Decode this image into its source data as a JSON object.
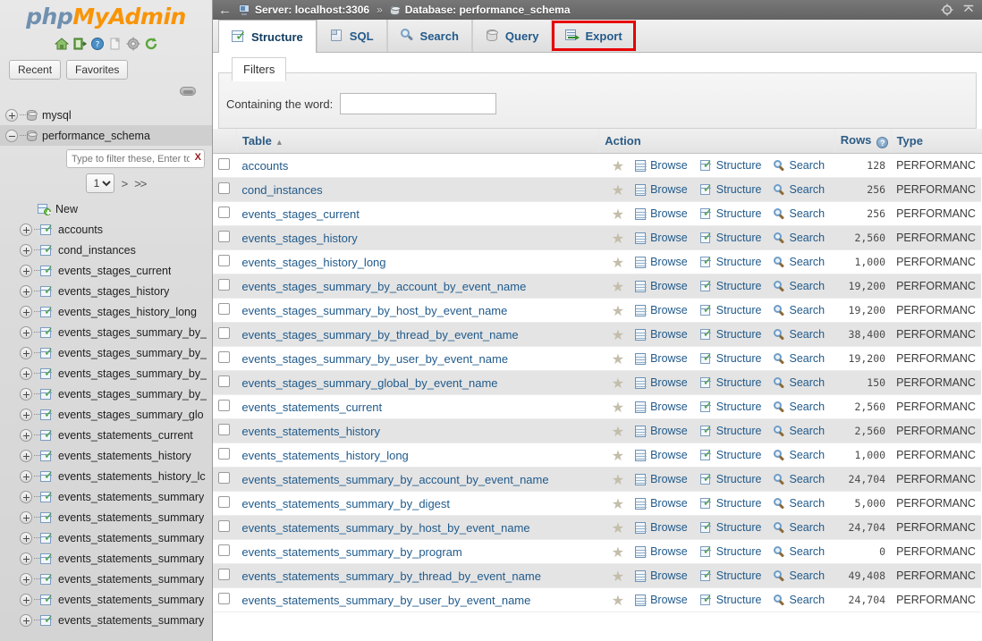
{
  "app": {
    "logo_php": "php",
    "logo_my": "My",
    "logo_admin": "Admin"
  },
  "sidebar": {
    "icons": [
      {
        "name": "home-icon",
        "title": "Home"
      },
      {
        "name": "logout-icon",
        "title": "Log out"
      },
      {
        "name": "help-icon",
        "title": "Documentation"
      },
      {
        "name": "docs-icon",
        "title": "phpMyAdmin documentation"
      },
      {
        "name": "settings-icon",
        "title": "Settings"
      },
      {
        "name": "reload-icon",
        "title": "Reload navigation"
      }
    ],
    "quick_buttons": [
      {
        "name": "recent-button",
        "label": "Recent"
      },
      {
        "name": "favorites-button",
        "label": "Favorites"
      }
    ],
    "tree": {
      "databases": [
        {
          "label": "mysql",
          "expanded": false
        },
        {
          "label": "performance_schema",
          "expanded": true
        }
      ],
      "filter": {
        "placeholder": "Type to filter these, Enter to searc",
        "value": "",
        "clear_label": "X"
      },
      "pager": {
        "page_value": "1",
        "options": [
          "1"
        ],
        "next_label": ">",
        "last_label": ">>"
      },
      "new_label": "New",
      "tables": [
        "accounts",
        "cond_instances",
        "events_stages_current",
        "events_stages_history",
        "events_stages_history_long",
        "events_stages_summary_by_",
        "events_stages_summary_by_",
        "events_stages_summary_by_",
        "events_stages_summary_by_",
        "events_stages_summary_glo",
        "events_statements_current",
        "events_statements_history",
        "events_statements_history_lc",
        "events_statements_summary",
        "events_statements_summary",
        "events_statements_summary",
        "events_statements_summary",
        "events_statements_summary",
        "events_statements_summary",
        "events_statements_summary"
      ]
    }
  },
  "header": {
    "back_label": "←",
    "server_label": "Server: localhost:3306",
    "separator": "»",
    "database_label": "Database: performance_schema",
    "gear_title": "Settings",
    "collapse_title": "Collapse"
  },
  "tabs": [
    {
      "label": "Structure",
      "icon": "structure-icon",
      "active": true,
      "highlighted": false
    },
    {
      "label": "SQL",
      "icon": "sql-icon",
      "active": false,
      "highlighted": false
    },
    {
      "label": "Search",
      "icon": "search-icon",
      "active": false,
      "highlighted": false
    },
    {
      "label": "Query",
      "icon": "query-icon",
      "active": false,
      "highlighted": false
    },
    {
      "label": "Export",
      "icon": "export-icon",
      "active": false,
      "highlighted": true
    }
  ],
  "filters": {
    "legend": "Filters",
    "word_label": "Containing the word:",
    "word_value": "",
    "word_placeholder": ""
  },
  "table": {
    "columns": {
      "table": "Table",
      "sort_arrow": "▲",
      "action": "Action",
      "rows": "Rows",
      "rows_info": "?",
      "type": "Type"
    },
    "action_labels": {
      "browse": "Browse",
      "structure": "Structure",
      "search": "Search",
      "favorite": "★"
    },
    "rows": [
      {
        "name": "accounts",
        "rows": "128",
        "type": "PERFORMANC"
      },
      {
        "name": "cond_instances",
        "rows": "256",
        "type": "PERFORMANC"
      },
      {
        "name": "events_stages_current",
        "rows": "256",
        "type": "PERFORMANC"
      },
      {
        "name": "events_stages_history",
        "rows": "2,560",
        "type": "PERFORMANC"
      },
      {
        "name": "events_stages_history_long",
        "rows": "1,000",
        "type": "PERFORMANC"
      },
      {
        "name": "events_stages_summary_by_account_by_event_name",
        "rows": "19,200",
        "type": "PERFORMANC"
      },
      {
        "name": "events_stages_summary_by_host_by_event_name",
        "rows": "19,200",
        "type": "PERFORMANC"
      },
      {
        "name": "events_stages_summary_by_thread_by_event_name",
        "rows": "38,400",
        "type": "PERFORMANC"
      },
      {
        "name": "events_stages_summary_by_user_by_event_name",
        "rows": "19,200",
        "type": "PERFORMANC"
      },
      {
        "name": "events_stages_summary_global_by_event_name",
        "rows": "150",
        "type": "PERFORMANC"
      },
      {
        "name": "events_statements_current",
        "rows": "2,560",
        "type": "PERFORMANC"
      },
      {
        "name": "events_statements_history",
        "rows": "2,560",
        "type": "PERFORMANC"
      },
      {
        "name": "events_statements_history_long",
        "rows": "1,000",
        "type": "PERFORMANC"
      },
      {
        "name": "events_statements_summary_by_account_by_event_name",
        "rows": "24,704",
        "type": "PERFORMANC"
      },
      {
        "name": "events_statements_summary_by_digest",
        "rows": "5,000",
        "type": "PERFORMANC"
      },
      {
        "name": "events_statements_summary_by_host_by_event_name",
        "rows": "24,704",
        "type": "PERFORMANC"
      },
      {
        "name": "events_statements_summary_by_program",
        "rows": "0",
        "type": "PERFORMANC"
      },
      {
        "name": "events_statements_summary_by_thread_by_event_name",
        "rows": "49,408",
        "type": "PERFORMANC"
      },
      {
        "name": "events_statements_summary_by_user_by_event_name",
        "rows": "24,704",
        "type": "PERFORMANC"
      }
    ]
  },
  "colors": {
    "accent_link": "#215b8c",
    "highlight_red": "#e60000",
    "logo_blue": "#7090b0",
    "logo_orange": "#f89406",
    "topbar_gray": "#636363"
  }
}
